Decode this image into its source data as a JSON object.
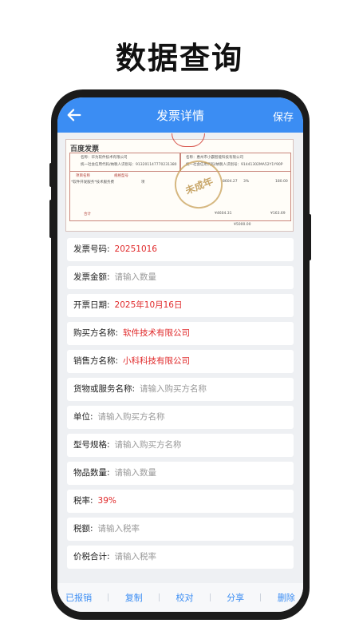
{
  "headline": "数据查询",
  "header": {
    "title": "发票详情",
    "save_label": "保存",
    "back_icon": "arrow-left-icon"
  },
  "invoice": {
    "title": "百度发票",
    "buyer_name": "名称：华为软件技术有限公司",
    "buyer_tax": "统一社会信用代码/纳税人识别号：913201147770231380",
    "seller_name": "名称：惠州市小霸智能科技有限公司",
    "seller_tax": "统一社会信用代码/纳税人识别号：91441302MA52Y1Y90P",
    "item_col": "项目名称",
    "spec_col": "规格型号",
    "item": "*软件开发服务*技术服务费",
    "unit_value": "项",
    "amount": "8604.27",
    "rate": "3%",
    "tax": "180.00",
    "total_label": "合计",
    "total": "¥4604.31",
    "total_tax": "¥163.69",
    "grand_total": "¥5000.00",
    "stamp_text": "未成年"
  },
  "fields": [
    {
      "label": "发票号码:",
      "value": "20251016",
      "kind": "value"
    },
    {
      "label": "发票金额:",
      "value": "请输入数量",
      "kind": "placeholder"
    },
    {
      "label": "开票日期:",
      "value": "2025年10月16日",
      "kind": "value"
    },
    {
      "label": "购买方名称:",
      "value": "软件技术有限公司",
      "kind": "value"
    },
    {
      "label": "销售方名称:",
      "value": "小科科技有限公司",
      "kind": "value"
    },
    {
      "label": "货物或服务名称:",
      "value": "请输入购买方名称",
      "kind": "placeholder"
    },
    {
      "label": "单位:",
      "value": "请输入购买方名称",
      "kind": "placeholder"
    },
    {
      "label": "型号规格:",
      "value": "请输入购买方名称",
      "kind": "placeholder"
    },
    {
      "label": "物品数量:",
      "value": "请输入数量",
      "kind": "placeholder"
    },
    {
      "label": "税率:",
      "value": "39%",
      "kind": "value"
    },
    {
      "label": "税额:",
      "value": "请输入税率",
      "kind": "placeholder"
    },
    {
      "label": "价税合计:",
      "value": "请输入税率",
      "kind": "placeholder"
    }
  ],
  "actions": [
    "已报销",
    "复制",
    "校对",
    "分享",
    "删除"
  ],
  "colors": {
    "primary": "#3b8df3",
    "value_red": "#e0292a",
    "placeholder": "#9a9a9a"
  }
}
